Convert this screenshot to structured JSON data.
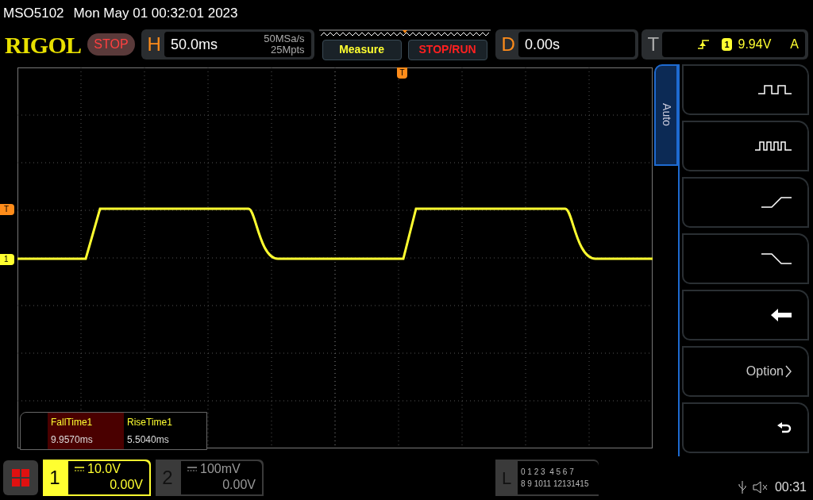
{
  "header": {
    "model": "MSO5102",
    "datetime": "Mon May 01 00:32:01 2023"
  },
  "toolbar": {
    "logo": "RIGOL",
    "run_state": "STOP",
    "horizontal": {
      "key": "H",
      "timebase": "50.0ms",
      "sample_rate": "50MSa/s",
      "memory_depth": "25Mpts"
    },
    "measure_button": "Measure",
    "stop_run_button": "STOP/RUN",
    "delay": {
      "key": "D",
      "value": "0.00s"
    },
    "trigger": {
      "key": "T",
      "source": "1",
      "level": "9.94V",
      "mode": "A"
    }
  },
  "markers": {
    "trigger": "T",
    "trigger_level": "T",
    "channel": "1"
  },
  "measurements": [
    {
      "name": "FallTime1",
      "value": "9.9570ms",
      "selected": true
    },
    {
      "name": "RiseTime1",
      "value": "5.5040ms",
      "selected": false
    }
  ],
  "side_menu": {
    "tab": "Auto",
    "items": [
      {
        "kind": "pulse"
      },
      {
        "kind": "pulses"
      },
      {
        "kind": "rise"
      },
      {
        "kind": "fall"
      },
      {
        "kind": "back"
      },
      {
        "kind": "option",
        "label": "Option"
      },
      {
        "kind": "undo"
      }
    ]
  },
  "channels": [
    {
      "number": "1",
      "scale": "10.0V",
      "offset": "0.00V",
      "selected": true
    },
    {
      "number": "2",
      "scale": "100mV",
      "offset": "0.00V",
      "selected": false
    }
  ],
  "logic": {
    "key": "L",
    "rows": [
      "0 1 2 3  4 5 6 7",
      "8 9 1011 12131415"
    ]
  },
  "status": {
    "time": "00:31"
  }
}
